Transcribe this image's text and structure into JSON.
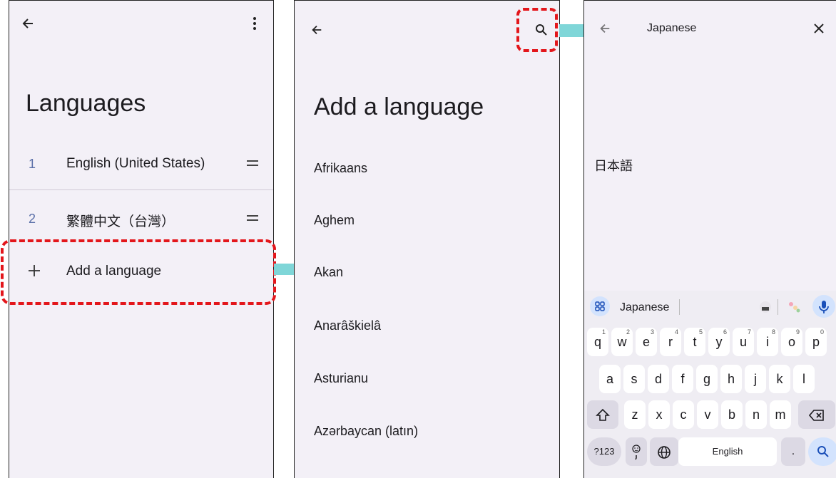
{
  "languages_screen": {
    "title": "Languages",
    "items": [
      {
        "num": "1",
        "label": "English (United States)"
      },
      {
        "num": "2",
        "label": "繁體中文（台灣）"
      }
    ],
    "add_label": "Add a language",
    "add_icon": "+"
  },
  "add_screen": {
    "title": "Add a language",
    "languages": [
      "Afrikaans",
      "Aghem",
      "Akan",
      "Anarâškielâ",
      "Asturianu",
      "Azərbaycan (latın)"
    ]
  },
  "search_screen": {
    "query": "Japanese",
    "result": "日本語"
  },
  "keyboard": {
    "suggestion": "Japanese",
    "row1": [
      [
        "q",
        "1"
      ],
      [
        "w",
        "2"
      ],
      [
        "e",
        "3"
      ],
      [
        "r",
        "4"
      ],
      [
        "t",
        "5"
      ],
      [
        "y",
        "6"
      ],
      [
        "u",
        "7"
      ],
      [
        "i",
        "8"
      ],
      [
        "o",
        "9"
      ],
      [
        "p",
        "0"
      ]
    ],
    "row2": [
      "a",
      "s",
      "d",
      "f",
      "g",
      "h",
      "j",
      "k",
      "l"
    ],
    "row3": [
      "z",
      "x",
      "c",
      "v",
      "b",
      "n",
      "m"
    ],
    "symbols_label": "?123",
    "space_label": "English",
    "period_label": "."
  },
  "colors": {
    "highlight_dash": "#e3161b",
    "arrow": "#7fd6d8"
  },
  "icons": {
    "back": "back-arrow-icon",
    "more": "more-vert-icon",
    "search": "search-icon",
    "close": "close-icon",
    "drag": "drag-handle-icon",
    "mic": "mic-icon",
    "globe": "globe-icon",
    "shift": "shift-icon",
    "backspace": "backspace-icon"
  }
}
